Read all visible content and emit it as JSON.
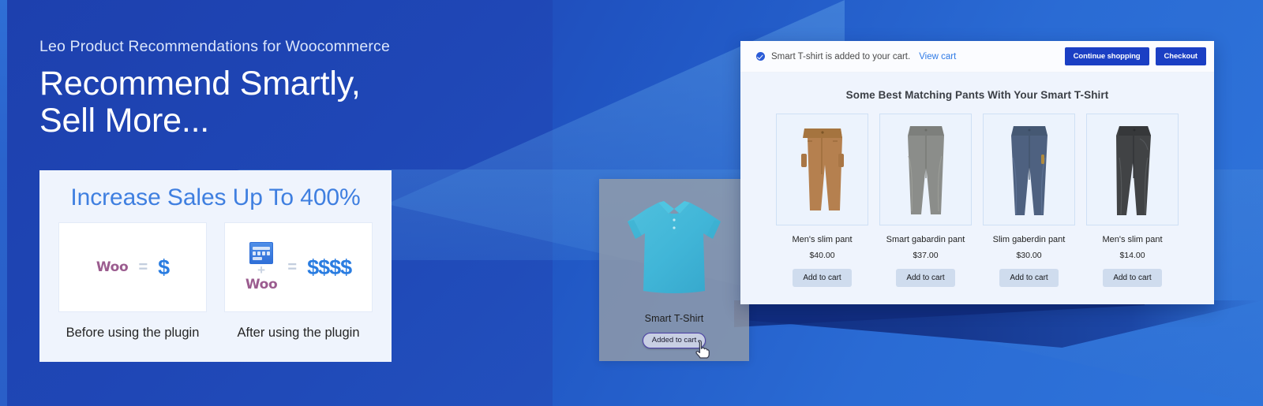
{
  "hero": {
    "eyebrow": "Leo Product Recommendations for Woocommerce",
    "headline_line1": "Recommend Smartly,",
    "headline_line2": "Sell More..."
  },
  "stat_card": {
    "title": "Increase Sales Up To 400%",
    "before": {
      "brand": "Woo",
      "equals": "=",
      "result": "$",
      "caption": "Before using the plugin"
    },
    "after": {
      "plugin_icon": "plugin-grid-icon",
      "plus": "+",
      "brand": "Woo",
      "equals": "=",
      "result": "$$$$",
      "caption": "After using the plugin"
    }
  },
  "tshirt_tile": {
    "image_alt": "teal-polo-shirt",
    "name": "Smart T-Shirt",
    "button_label": "Added to cart",
    "cursor": "pointer-hand-cursor"
  },
  "window": {
    "notice": {
      "icon": "check-circle-icon",
      "message": "Smart T-shirt is added to your cart.",
      "link_label": "View cart"
    },
    "actions": [
      {
        "label": "Continue shopping",
        "name": "continue-shopping-button"
      },
      {
        "label": "Checkout",
        "name": "checkout-button"
      }
    ],
    "recommendation_title": "Some Best Matching Pants With Your Smart T-Shirt",
    "add_to_cart_label": "Add to cart",
    "products": [
      {
        "name": "Men's slim pant",
        "price": "$40.00",
        "color": "#b5804f",
        "image_alt": "tan-cargo-pants"
      },
      {
        "name": "Smart gabardin pant",
        "price": "$37.00",
        "color": "#8b8d8a",
        "image_alt": "gray-pants"
      },
      {
        "name": "Slim gaberdin pant",
        "price": "$30.00",
        "color": "#4e6180",
        "image_alt": "slate-blue-pants"
      },
      {
        "name": "Men's slim pant",
        "price": "$14.00",
        "color": "#414345",
        "image_alt": "charcoal-pants"
      }
    ]
  },
  "colors": {
    "background_blue": "#1f47b5",
    "accent_blue": "#2a7de1",
    "title_blue": "#3f7fe0",
    "woo_purple": "#9b5c8f",
    "button_navy": "#1b3fc4"
  }
}
